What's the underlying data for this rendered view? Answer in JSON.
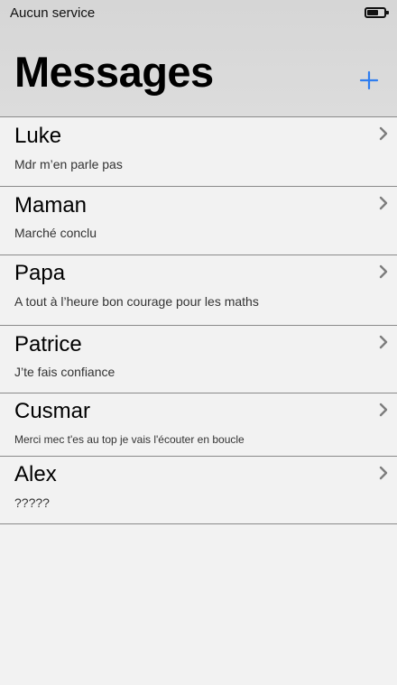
{
  "status_bar": {
    "carrier": "Aucun service",
    "battery_level": 0.6
  },
  "header": {
    "title": "Messages",
    "add_icon": "plus-icon",
    "accent_color": "#2f7ef0"
  },
  "conversations": [
    {
      "name": "Luke",
      "preview": "Mdr m’en parle pas"
    },
    {
      "name": "Maman",
      "preview": "Marché conclu"
    },
    {
      "name": "Papa",
      "preview": "A tout à l’heure bon courage pour les maths"
    },
    {
      "name": "Patrice",
      "preview": "J’te fais confiance"
    },
    {
      "name": "Cusmar",
      "preview": "Merci mec t'es au top je vais l'écouter en boucle"
    },
    {
      "name": "Alex",
      "preview": "?????"
    }
  ],
  "row_icon": "chevron-right-icon"
}
